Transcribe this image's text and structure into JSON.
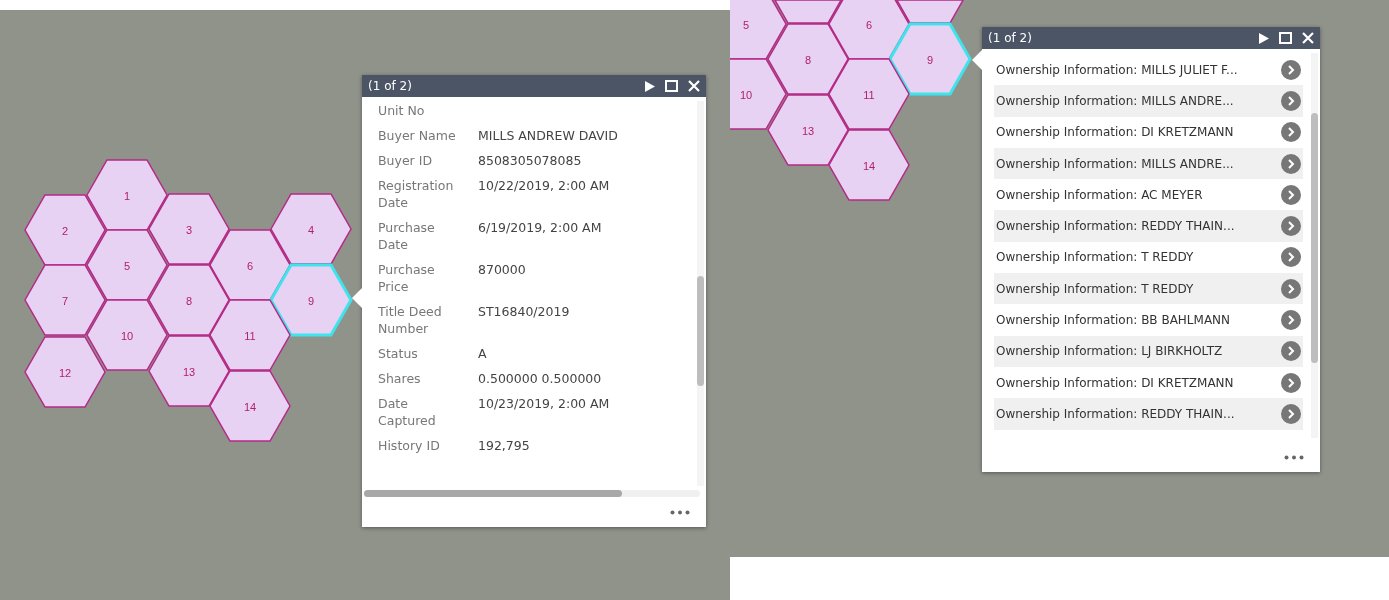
{
  "left_map": {
    "hexagons": [
      {
        "label": "1",
        "selected": false
      },
      {
        "label": "2",
        "selected": false
      },
      {
        "label": "3",
        "selected": false
      },
      {
        "label": "4",
        "selected": false
      },
      {
        "label": "5",
        "selected": false
      },
      {
        "label": "6",
        "selected": false
      },
      {
        "label": "7",
        "selected": false
      },
      {
        "label": "8",
        "selected": false
      },
      {
        "label": "9",
        "selected": true
      },
      {
        "label": "10",
        "selected": false
      },
      {
        "label": "11",
        "selected": false
      },
      {
        "label": "12",
        "selected": false
      },
      {
        "label": "13",
        "selected": false
      },
      {
        "label": "14",
        "selected": false
      }
    ],
    "popup": {
      "title": "(1 of 2)",
      "fields": [
        {
          "label": "Unit No"
        },
        {
          "label": "Buyer Name",
          "value": "MILLS ANDREW DAVID"
        },
        {
          "label": "Buyer ID",
          "value": "8508305078085"
        },
        {
          "label": "Registration Date",
          "value": "10/22/2019, 2:00 AM"
        },
        {
          "label": "Purchase Date",
          "value": "6/19/2019, 2:00 AM"
        },
        {
          "label": "Purchase Price",
          "value": "870000"
        },
        {
          "label": "Title Deed Number",
          "value": "ST16840/2019"
        },
        {
          "label": "Status",
          "value": "A"
        },
        {
          "label": "Shares",
          "value": "0.500000 0.500000"
        },
        {
          "label": "Date Captured",
          "value": "10/23/2019, 2:00 AM"
        },
        {
          "label": "History ID",
          "value": "192,795"
        }
      ]
    }
  },
  "right_map": {
    "hexagons": [
      {
        "label": "5",
        "selected": false
      },
      {
        "label": "6",
        "selected": false
      },
      {
        "label": "8",
        "selected": false
      },
      {
        "label": "9",
        "selected": true
      },
      {
        "label": "10",
        "selected": false
      },
      {
        "label": "11",
        "selected": false
      },
      {
        "label": "13",
        "selected": false
      },
      {
        "label": "14",
        "selected": false
      }
    ],
    "popup": {
      "title": "(1 of 2)",
      "items": [
        "Ownership Information: MILLS JULIET F...",
        "Ownership Information: MILLS ANDRE...",
        "Ownership Information: DI KRETZMANN",
        "Ownership Information: MILLS ANDRE...",
        "Ownership Information: AC MEYER",
        "Ownership Information: REDDY THAIN...",
        "Ownership Information: T REDDY",
        "Ownership Information: T REDDY",
        "Ownership Information: BB BAHLMANN",
        "Ownership Information: LJ BIRKHOLTZ",
        "Ownership Information: DI KRETZMANN",
        "Ownership Information: REDDY THAIN..."
      ]
    }
  }
}
